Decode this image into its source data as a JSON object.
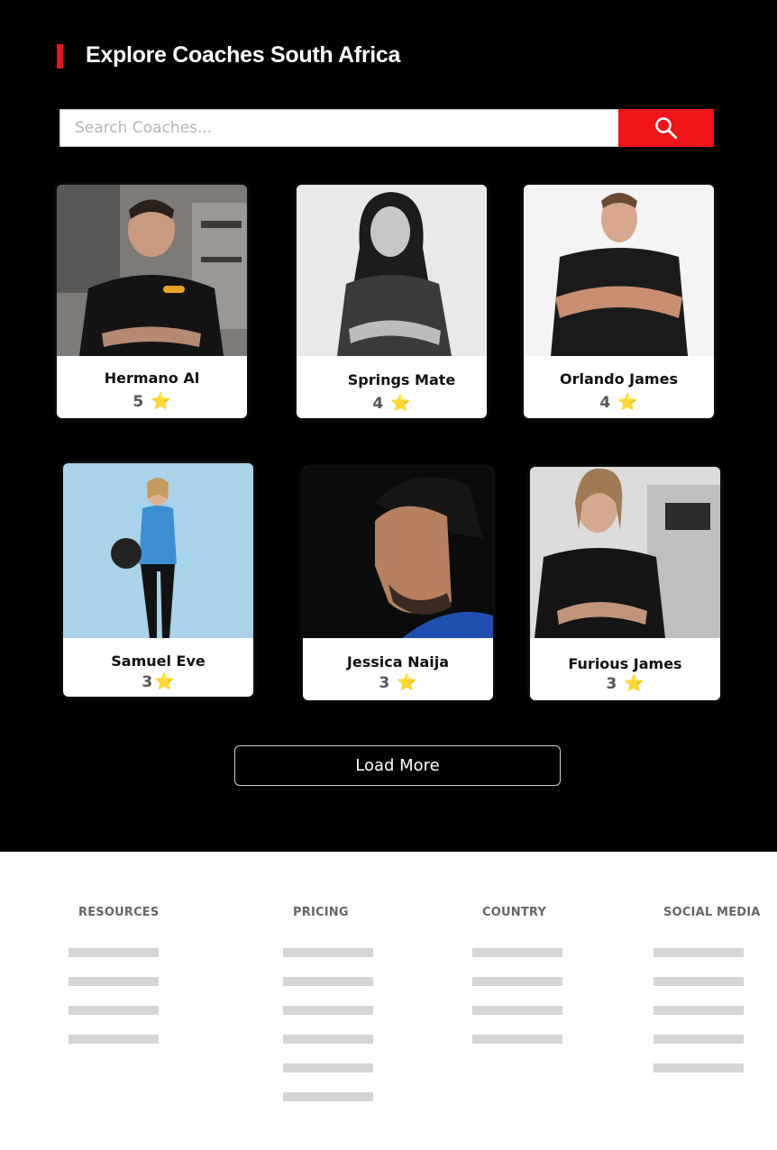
{
  "header": {
    "title": "Explore Coaches South Africa"
  },
  "search": {
    "placeholder": "Search Coaches...",
    "button_icon": "search-icon"
  },
  "coaches": [
    {
      "name": "Hermano Al",
      "rating": "5",
      "star": "⭐"
    },
    {
      "name": "Springs Mate",
      "rating": "4",
      "star": "⭐"
    },
    {
      "name": "Orlando James",
      "rating": "4",
      "star": "⭐"
    },
    {
      "name": "Samuel Eve",
      "rating": "3",
      "star": "⭐"
    },
    {
      "name": "Jessica Naija",
      "rating": "3",
      "star": "⭐"
    },
    {
      "name": "Furious James",
      "rating": "3",
      "star": "⭐"
    }
  ],
  "load_more": {
    "label": "Load More"
  },
  "footer": {
    "columns": [
      {
        "title": "RESOURCES"
      },
      {
        "title": "PRICING"
      },
      {
        "title": "COUNTRY"
      },
      {
        "title": "SOCIAL MEDIA"
      }
    ]
  },
  "colors": {
    "accent": "#f0141b",
    "background": "#000000",
    "star": "#f2b71f",
    "placeholder_line": "#d6d6d6"
  }
}
